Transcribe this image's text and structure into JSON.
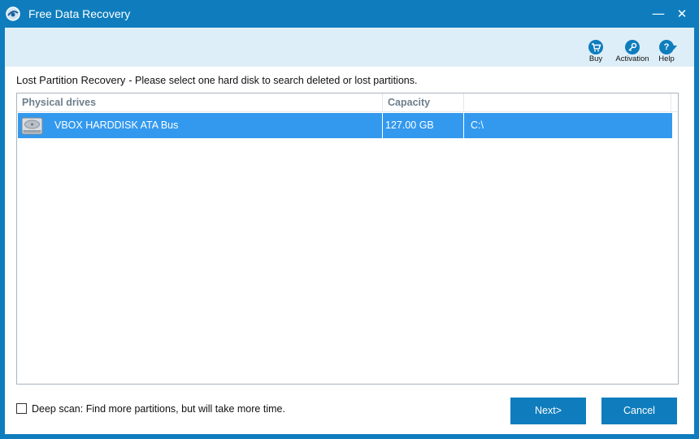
{
  "window": {
    "title": "Free Data Recovery",
    "minimize_glyph": "—",
    "close_glyph": "✕"
  },
  "toolbar": {
    "buy_label": "Buy",
    "activation_label": "Activation",
    "help_label": "Help",
    "buy_icon": "cart-icon",
    "activation_icon": "key-icon",
    "help_icon": "question-icon"
  },
  "heading": {
    "title": "Lost Partition Recovery",
    "subtitle": "- Please select one hard disk to search deleted or lost partitions."
  },
  "drive_list": {
    "columns": [
      "Physical drives",
      "Capacity",
      ""
    ],
    "rows": [
      {
        "name": "VBOX HARDDISK  ATA Bus",
        "capacity": "127.00 GB",
        "volumes": "C:\\",
        "selected": true
      }
    ]
  },
  "options": {
    "deep_scan_label": "Deep scan: Find more partitions, but will take more time.",
    "deep_scan_checked": false
  },
  "buttons": {
    "next": "Next>",
    "cancel": "Cancel"
  },
  "colors": {
    "accent": "#0f7dbd",
    "selection": "#3399ee",
    "toolbar_bg": "#ddeef8"
  }
}
